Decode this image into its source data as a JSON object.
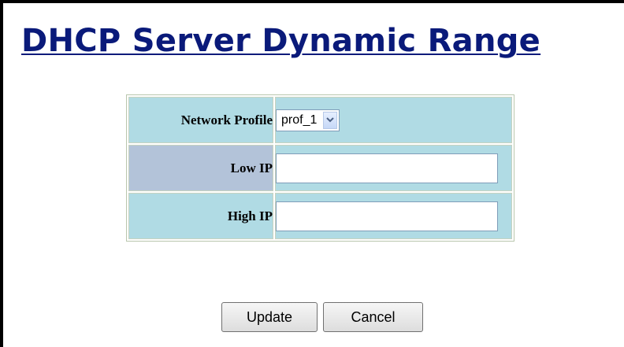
{
  "page": {
    "title": "DHCP Server Dynamic Range"
  },
  "form": {
    "network_profile": {
      "label": "Network Profile",
      "selected": "prof_1"
    },
    "low_ip": {
      "label": "Low IP",
      "value": ""
    },
    "high_ip": {
      "label": "High IP",
      "value": ""
    }
  },
  "buttons": {
    "update_label": "Update",
    "cancel_label": "Cancel"
  },
  "colors": {
    "title": "#0a1a7a",
    "row_bg": "#b0dbe4",
    "alt_label_bg": "#b3c3d9"
  },
  "icons": {
    "select_arrow": "chevron-down-icon"
  }
}
